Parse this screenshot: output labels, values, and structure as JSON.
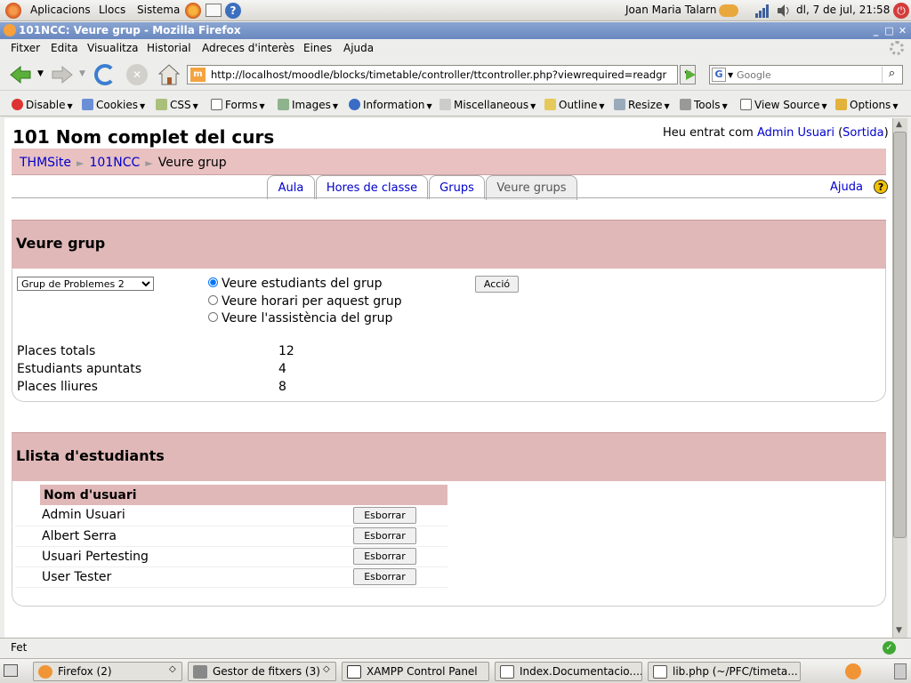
{
  "gnome_panel": {
    "menus": [
      "Aplicacions",
      "Llocs",
      "Sistema"
    ],
    "user": "Joan Maria Talarn",
    "clock": "dl,  7 de jul, 21:58"
  },
  "window": {
    "title": "101NCC: Veure grup - Mozilla Firefox"
  },
  "menubar": [
    "Fitxer",
    "Edita",
    "Visualitza",
    "Historial",
    "Adreces d'interès",
    "Eines",
    "Ajuda"
  ],
  "navigation": {
    "url": "http://localhost/moodle/blocks/timetable/controller/ttcontroller.php?viewrequired=readgr",
    "search_placeholder": "Google"
  },
  "webdev_toolbar": [
    "Disable",
    "Cookies",
    "CSS",
    "Forms",
    "Images",
    "Information",
    "Miscellaneous",
    "Outline",
    "Resize",
    "Tools",
    "View Source",
    "Options"
  ],
  "page": {
    "course_title": "101 Nom complet del curs",
    "login_prefix": "Heu entrat com",
    "login_user": "Admin Usuari",
    "logout": "Sortida",
    "breadcrumb": [
      "THMSite",
      "101NCC",
      "Veure grup"
    ],
    "tabs": [
      "Aula",
      "Hores de classe",
      "Grups",
      "Veure grups"
    ],
    "help": "Ajuda",
    "group_box": {
      "title": "Veure grup",
      "selected_group": "Grup de Problemes 2",
      "options": [
        "Veure estudiants del grup",
        "Veure horari per aquest grup",
        "Veure l'assistència del grup"
      ],
      "action_button": "Acció",
      "stats": [
        {
          "label": "Places totals",
          "value": "12"
        },
        {
          "label": "Estudiants apuntats",
          "value": "4"
        },
        {
          "label": "Places lliures",
          "value": "8"
        }
      ]
    },
    "student_box": {
      "title": "Llista d'estudiants",
      "column_header": "Nom d'usuari",
      "delete_label": "Esborrar",
      "students": [
        "Admin Usuari",
        "Albert Serra",
        "Usuari Pertesting",
        "User Tester"
      ]
    }
  },
  "status_bar": {
    "text": "Fet"
  },
  "taskbar": {
    "tasks": [
      "Firefox (2)",
      "Gestor de fitxers (3)",
      "XAMPP Control Panel",
      "Index.Documentacio....",
      "lib.php (~/PFC/timeta..."
    ]
  },
  "colors": {
    "moodle_header": "#e0b8b8",
    "link": "#0000cc",
    "title_bar": "#6a88c0"
  }
}
